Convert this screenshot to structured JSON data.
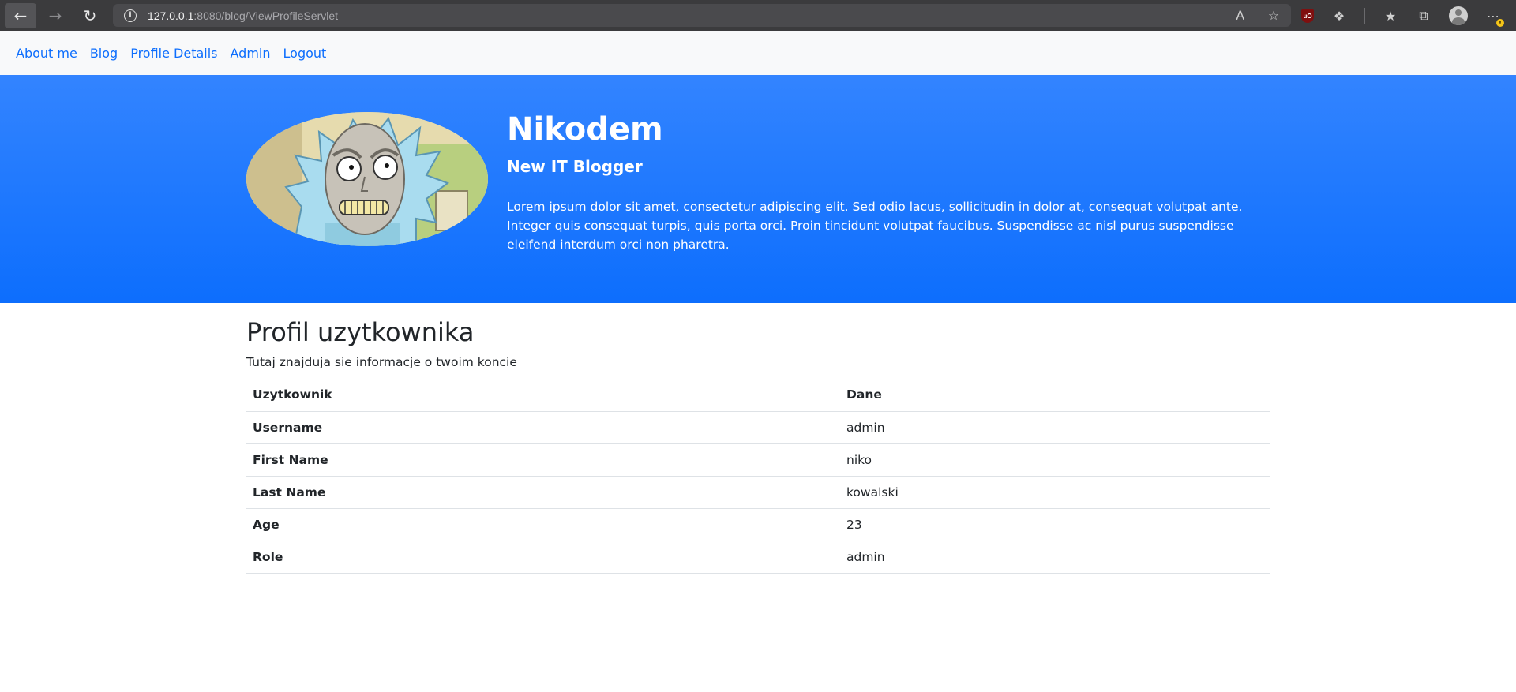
{
  "browser": {
    "url_host": "127.0.0.1",
    "url_rest": ":8080/blog/ViewProfileServlet",
    "ublock_label": "uO"
  },
  "nav": {
    "items": [
      {
        "label": "About me"
      },
      {
        "label": "Blog"
      },
      {
        "label": "Profile Details"
      },
      {
        "label": "Admin"
      },
      {
        "label": "Logout"
      }
    ]
  },
  "hero": {
    "name": "Nikodem",
    "subtitle": "New IT Blogger",
    "description": "Lorem ipsum dolor sit amet, consectetur adipiscing elit. Sed odio lacus, sollicitudin in dolor at, consequat volutpat ante. Integer quis consequat turpis, quis porta orci. Proin tincidunt volutpat faucibus. Suspendisse ac nisl purus suspendisse eleifend interdum orci non pharetra."
  },
  "main": {
    "title": "Profil uzytkownika",
    "lead": "Tutaj znajduja sie informacje o twoim koncie",
    "table": {
      "headers": [
        "Uzytkownik",
        "Dane"
      ],
      "rows": [
        {
          "label": "Username",
          "value": "admin"
        },
        {
          "label": "First Name",
          "value": "niko"
        },
        {
          "label": "Last Name",
          "value": "kowalski"
        },
        {
          "label": "Age",
          "value": "23"
        },
        {
          "label": "Role",
          "value": "admin"
        }
      ]
    }
  },
  "colors": {
    "primary": "#0d6efd",
    "hero_top": "#3384ff",
    "nav_bg": "#f8f9fa"
  },
  "icons": {
    "back": "arrow-left-icon",
    "forward": "arrow-right-icon",
    "reload": "reload-icon",
    "info": "info-icon",
    "read_aloud": "read-aloud-icon",
    "favorite": "star-add-icon",
    "extensions": "puzzle-icon",
    "favorites": "favorites-list-icon",
    "collections": "collections-icon",
    "profile": "avatar-icon",
    "more": "more-icon"
  }
}
